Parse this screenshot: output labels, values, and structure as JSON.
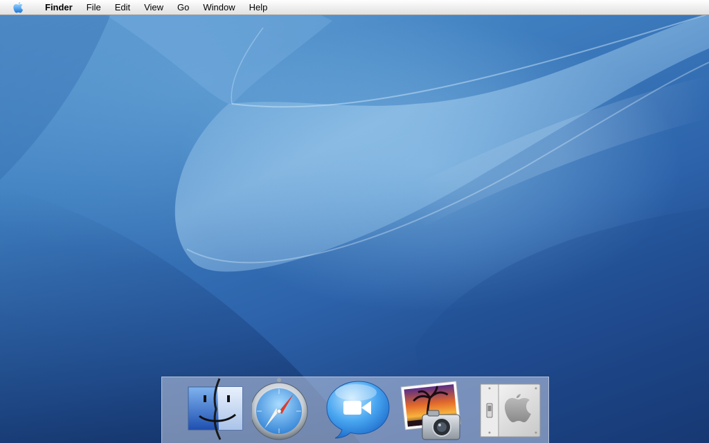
{
  "menubar": {
    "apple_icon": "apple-icon",
    "app_name": "Finder",
    "items": [
      {
        "label": "File"
      },
      {
        "label": "Edit"
      },
      {
        "label": "View"
      },
      {
        "label": "Go"
      },
      {
        "label": "Window"
      },
      {
        "label": "Help"
      }
    ]
  },
  "desktop": {
    "wallpaper": "blue-aurora-wallpaper"
  },
  "dock": {
    "items": [
      {
        "icon": "finder-icon"
      },
      {
        "icon": "safari-icon"
      },
      {
        "icon": "ichat-icon"
      },
      {
        "icon": "iphoto-icon"
      },
      {
        "icon": "system-preferences-icon"
      }
    ]
  },
  "colors": {
    "wallpaper_light": "#6aaee0",
    "wallpaper_dark": "#122e62",
    "menubar_bg": "#ececec",
    "dock_bg": "#c3cde6"
  }
}
